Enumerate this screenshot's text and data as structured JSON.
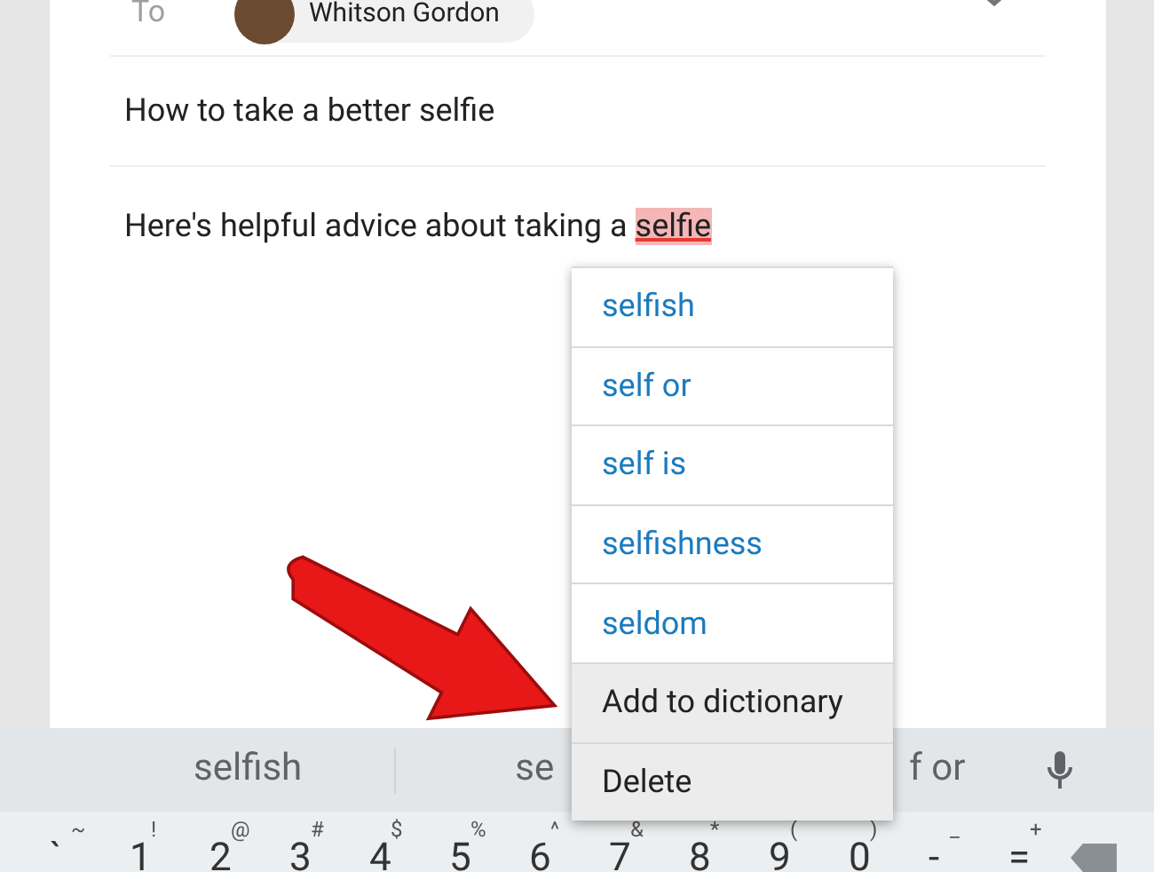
{
  "recipient": {
    "label": "To",
    "name": "Whitson Gordon"
  },
  "subject": "How to take a better selfie",
  "body": {
    "text": "Here's helpful advice about taking a",
    "flagged_word": "selfie",
    "flagged": true
  },
  "spell_menu": [
    {
      "kind": "suggestion",
      "label": "selfish"
    },
    {
      "kind": "suggestion",
      "label": "self or"
    },
    {
      "kind": "suggestion",
      "label": "self is"
    },
    {
      "kind": "suggestion",
      "label": "selfishness"
    },
    {
      "kind": "suggestion",
      "label": "seldom"
    },
    {
      "kind": "action",
      "label": "Add to dictionary"
    },
    {
      "kind": "action",
      "label": "Delete"
    }
  ],
  "keyboard": {
    "suggestions": [
      "selfish",
      "se",
      "f or"
    ],
    "number_row": [
      {
        "main": "`",
        "alt": "~"
      },
      {
        "main": "1",
        "alt": "!"
      },
      {
        "main": "2",
        "alt": "@"
      },
      {
        "main": "3",
        "alt": "#"
      },
      {
        "main": "4",
        "alt": "$"
      },
      {
        "main": "5",
        "alt": "%"
      },
      {
        "main": "6",
        "alt": "^"
      },
      {
        "main": "7",
        "alt": "&"
      },
      {
        "main": "8",
        "alt": "*"
      },
      {
        "main": "9",
        "alt": "("
      },
      {
        "main": "0",
        "alt": ")"
      },
      {
        "main": "-",
        "alt": "_"
      },
      {
        "main": "=",
        "alt": "+"
      }
    ]
  }
}
